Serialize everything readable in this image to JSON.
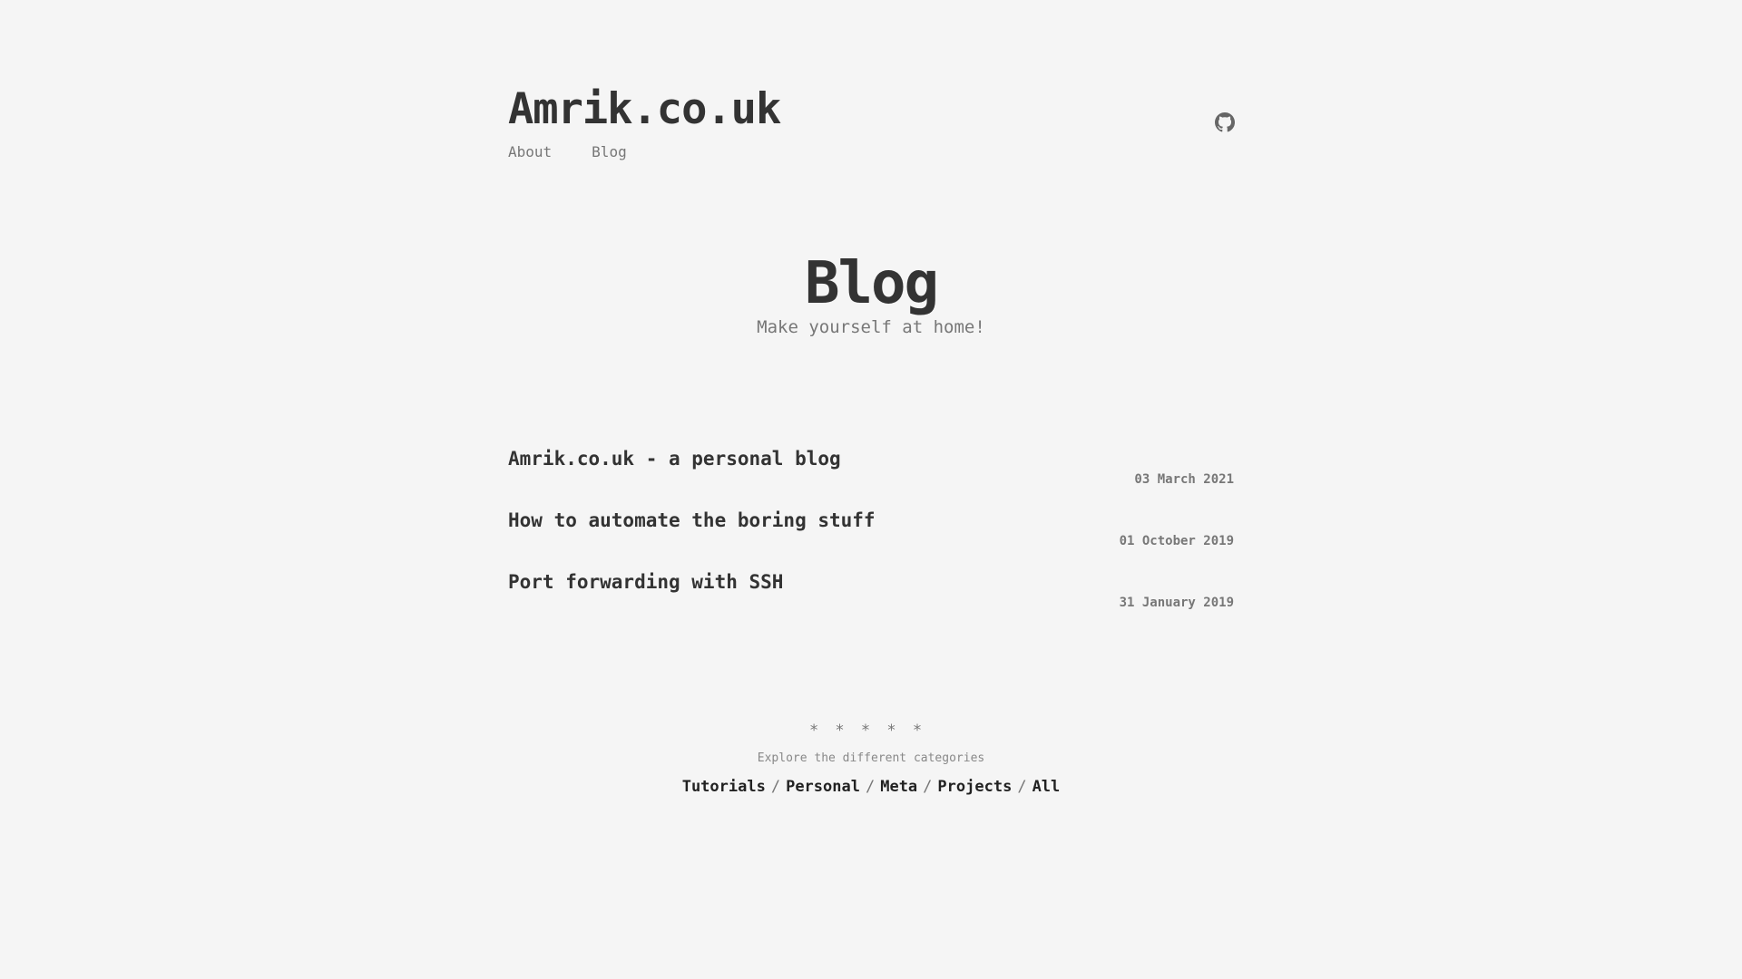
{
  "header": {
    "site_title": "Amrik.co.uk",
    "nav": [
      {
        "label": "About"
      },
      {
        "label": "Blog"
      }
    ],
    "github_icon": "github-icon"
  },
  "hero": {
    "title": "Blog",
    "subtitle": "Make yourself at home!"
  },
  "posts": [
    {
      "title": "Amrik.co.uk - a personal blog",
      "date": "03 March 2021"
    },
    {
      "title": "How to automate the boring stuff",
      "date": "01 October 2019"
    },
    {
      "title": "Port forwarding with SSH",
      "date": "31 January 2019"
    }
  ],
  "footer": {
    "divider": "* * * * *",
    "explore_text": "Explore the different categories",
    "separator": "/",
    "categories": [
      {
        "label": "Tutorials"
      },
      {
        "label": "Personal"
      },
      {
        "label": "Meta"
      },
      {
        "label": "Projects"
      },
      {
        "label": "All"
      }
    ]
  },
  "colors": {
    "background": "#f5f5f5",
    "text": "#333333",
    "muted": "#777777"
  }
}
